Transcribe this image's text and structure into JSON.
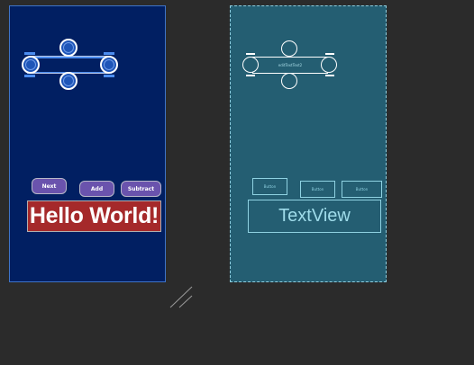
{
  "design": {
    "buttons": {
      "next": "Next",
      "add": "Add",
      "subtract": "Subtract"
    },
    "textview_text": "Hello World!"
  },
  "blueprint": {
    "edittext_label": "editTextText2",
    "buttons": [
      "Button",
      "Button",
      "Button"
    ],
    "textview_text": "TextView"
  },
  "colors": {
    "design_background": "#011f62",
    "blueprint_background": "#245e72",
    "button_color": "#6a53ad",
    "textview_background": "#a5292a",
    "canvas_background": "#2b2b2b"
  },
  "icons": {
    "resize_handle": "diagonal-resize-icon"
  }
}
